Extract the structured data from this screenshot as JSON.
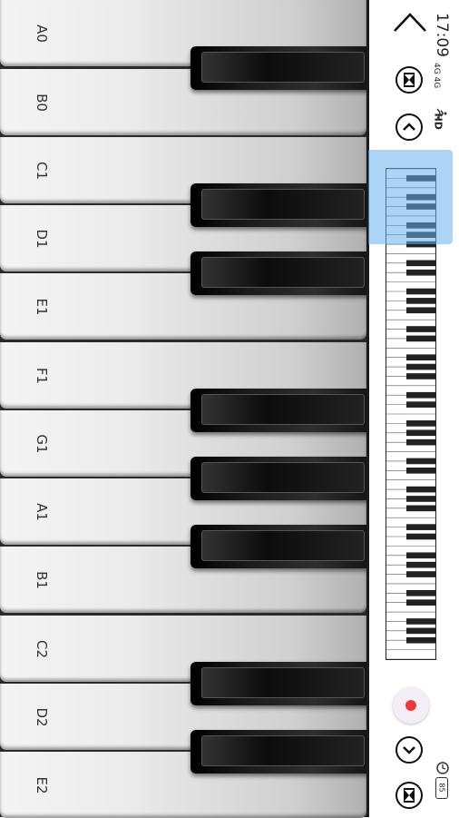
{
  "status_bar": {
    "time": "17:09",
    "network": "4G 4G",
    "hd": "HD",
    "battery": "85"
  },
  "controls": {
    "back": "back",
    "skip_top": "skip",
    "scroll_up": "up",
    "scroll_down": "down",
    "skip_bottom": "skip",
    "record": "record"
  },
  "keys": {
    "white": [
      "A0",
      "B0",
      "C1",
      "D1",
      "E1",
      "F1",
      "G1",
      "A1",
      "B1",
      "C2",
      "D2",
      "E2"
    ]
  },
  "colors": {
    "highlight": "#67b1ec",
    "record_dot": "#ef3a3a"
  }
}
